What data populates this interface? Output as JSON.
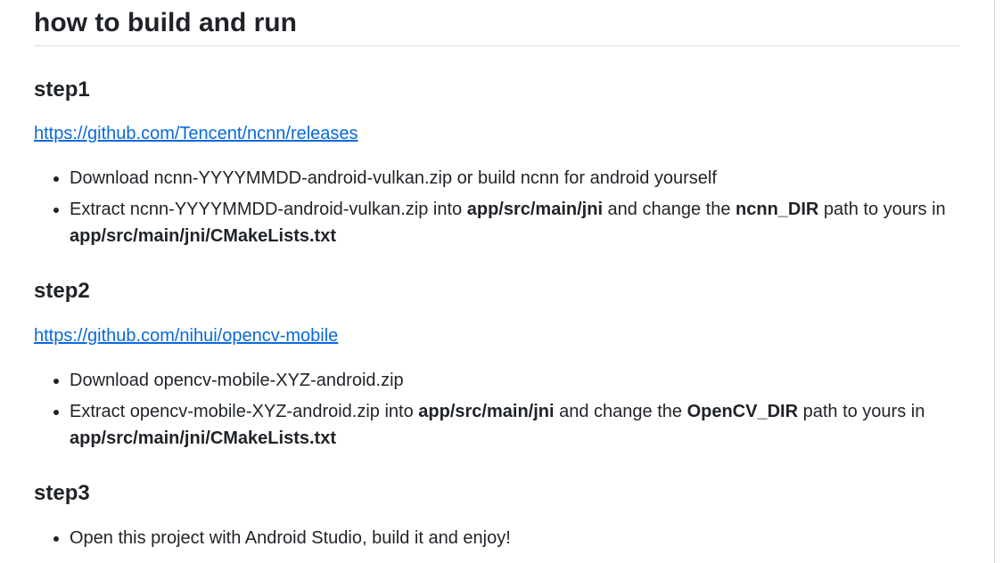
{
  "title": "how to build and run",
  "steps": [
    {
      "heading": "step1",
      "link": "https://github.com/Tencent/ncnn/releases",
      "items": [
        {
          "text": "Download ncnn-YYYYMMDD-android-vulkan.zip or build ncnn for android yourself"
        },
        {
          "t1": "Extract ncnn-YYYYMMDD-android-vulkan.zip into ",
          "b1": "app/src/main/jni",
          "t2": " and change the ",
          "b2": "ncnn_DIR",
          "t3": " path to yours in ",
          "b3": "app/src/main/jni/CMakeLists.txt"
        }
      ]
    },
    {
      "heading": "step2",
      "link": "https://github.com/nihui/opencv-mobile",
      "items": [
        {
          "text": "Download opencv-mobile-XYZ-android.zip"
        },
        {
          "t1": "Extract opencv-mobile-XYZ-android.zip into ",
          "b1": "app/src/main/jni",
          "t2": " and change the ",
          "b2": "OpenCV_DIR",
          "t3": " path to yours in ",
          "b3": "app/src/main/jni/CMakeLists.txt"
        }
      ]
    },
    {
      "heading": "step3",
      "items": [
        {
          "text": "Open this project with Android Studio, build it and enjoy!"
        }
      ]
    }
  ]
}
